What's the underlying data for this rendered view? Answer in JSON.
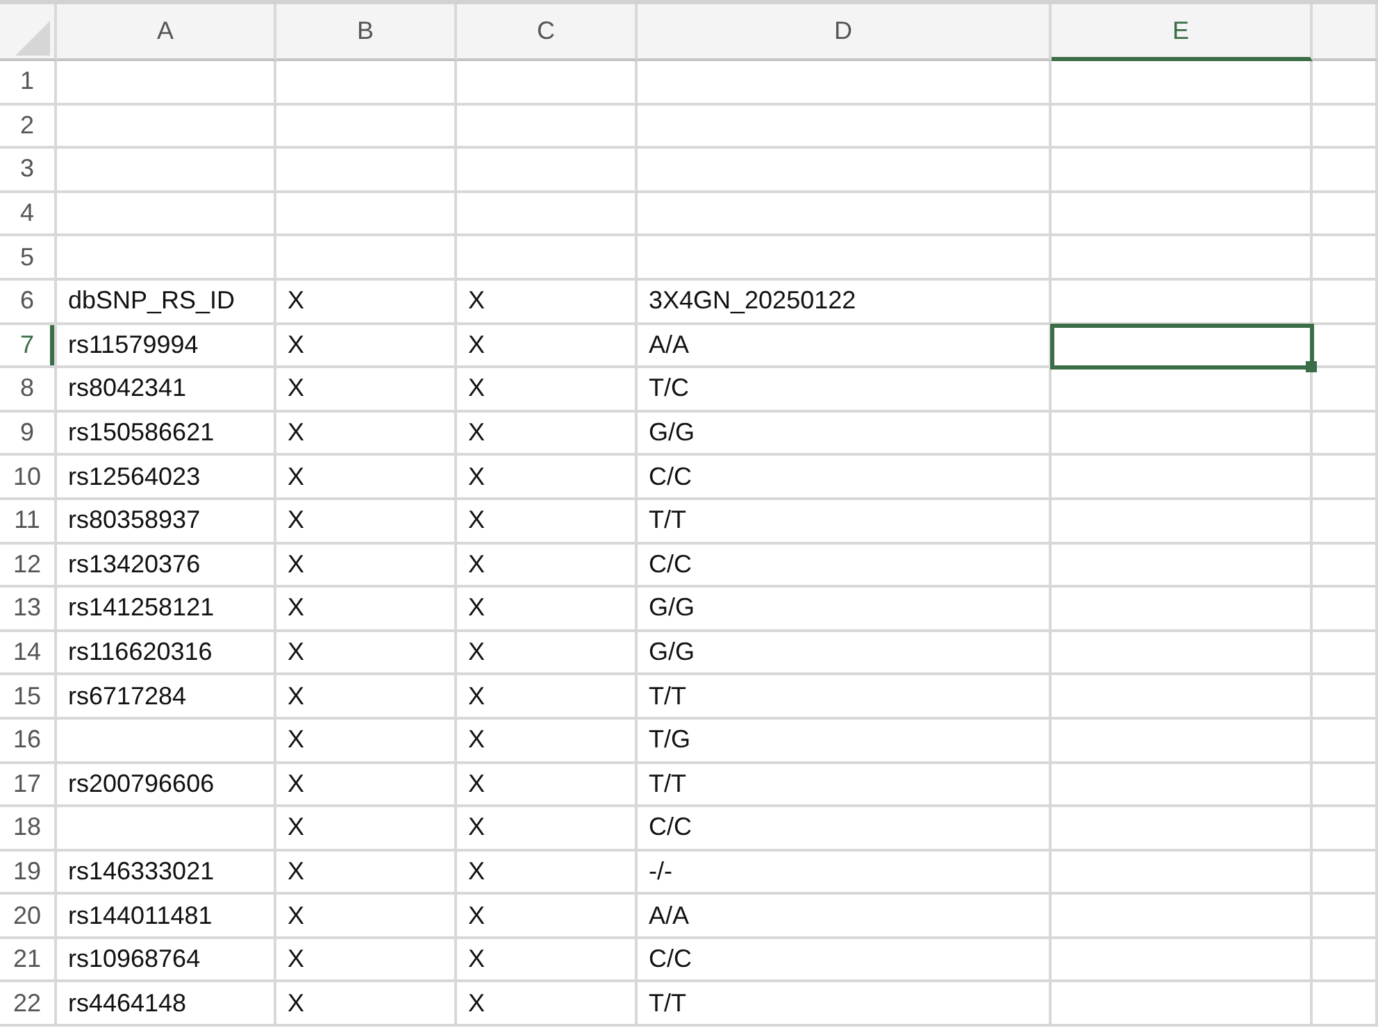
{
  "columns": [
    {
      "label": "A",
      "selected": false
    },
    {
      "label": "B",
      "selected": false
    },
    {
      "label": "C",
      "selected": false
    },
    {
      "label": "D",
      "selected": false
    },
    {
      "label": "E",
      "selected": true
    }
  ],
  "rows": [
    {
      "number": "1",
      "selected": false
    },
    {
      "number": "2",
      "selected": false
    },
    {
      "number": "3",
      "selected": false
    },
    {
      "number": "4",
      "selected": false
    },
    {
      "number": "5",
      "selected": false
    },
    {
      "number": "6",
      "selected": false,
      "cells": [
        "dbSNP_RS_ID",
        "X",
        "X",
        "3X4GN_20250122"
      ]
    },
    {
      "number": "7",
      "selected": true,
      "cells": [
        "rs11579994",
        "X",
        "X",
        "A/A"
      ]
    },
    {
      "number": "8",
      "selected": false,
      "cells": [
        "rs8042341",
        "X",
        "X",
        "T/C"
      ]
    },
    {
      "number": "9",
      "selected": false,
      "cells": [
        "rs150586621",
        "X",
        "X",
        "G/G"
      ]
    },
    {
      "number": "10",
      "selected": false,
      "cells": [
        "rs12564023",
        "X",
        "X",
        "C/C"
      ]
    },
    {
      "number": "11",
      "selected": false,
      "cells": [
        "rs80358937",
        "X",
        "X",
        "T/T"
      ]
    },
    {
      "number": "12",
      "selected": false,
      "cells": [
        "rs13420376",
        "X",
        "X",
        "C/C"
      ]
    },
    {
      "number": "13",
      "selected": false,
      "cells": [
        "rs141258121",
        "X",
        "X",
        "G/G"
      ]
    },
    {
      "number": "14",
      "selected": false,
      "cells": [
        "rs116620316",
        "X",
        "X",
        "G/G"
      ]
    },
    {
      "number": "15",
      "selected": false,
      "cells": [
        "rs6717284",
        "X",
        "X",
        "T/T"
      ]
    },
    {
      "number": "16",
      "selected": false,
      "cells": [
        null,
        "X",
        "X",
        "T/G"
      ]
    },
    {
      "number": "17",
      "selected": false,
      "cells": [
        "rs200796606",
        "X",
        "X",
        "T/T"
      ]
    },
    {
      "number": "18",
      "selected": false,
      "cells": [
        null,
        "X",
        "X",
        "C/C"
      ]
    },
    {
      "number": "19",
      "selected": false,
      "cells": [
        "rs146333021",
        "X",
        "X",
        "-/-"
      ]
    },
    {
      "number": "20",
      "selected": false,
      "cells": [
        "rs144011481",
        "X",
        "X",
        "A/A"
      ]
    },
    {
      "number": "21",
      "selected": false,
      "cells": [
        "rs10968764",
        "X",
        "X",
        "C/C"
      ]
    },
    {
      "number": "22",
      "selected": false,
      "cells": [
        "rs4464148",
        "X",
        "X",
        "T/T"
      ]
    }
  ]
}
